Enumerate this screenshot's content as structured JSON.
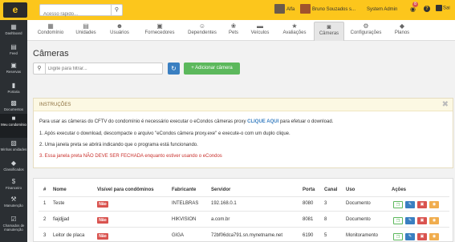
{
  "topbar": {
    "logo": "e",
    "search_placeholder": "Acesso rápido...",
    "search_icon": "search-icon",
    "user1": "Alfa",
    "user2": "Bruno Souzados s...",
    "role": "System Admin",
    "notifications": "8",
    "help": "?",
    "logout": "Sai"
  },
  "sidebar": {
    "items": [
      {
        "label": "Dashboard",
        "icon": "dashboard-icon"
      },
      {
        "label": "Feed",
        "icon": "feed-icon"
      },
      {
        "label": "Reservas",
        "icon": "calendar-icon"
      },
      {
        "label": "Portaria",
        "icon": "door-icon"
      },
      {
        "label": "Documentos",
        "icon": "documents-icon"
      },
      {
        "label": "Meu condomínio",
        "icon": "building-icon"
      },
      {
        "label": "Minhas unidades",
        "icon": "units-icon"
      },
      {
        "label": "Classificados",
        "icon": "classifieds-icon"
      },
      {
        "label": "Financeiro",
        "icon": "dollar-icon"
      },
      {
        "label": "Manutenção",
        "icon": "wrench-icon"
      },
      {
        "label": "Chamados de manutenção",
        "icon": "ticket-icon"
      }
    ]
  },
  "tabs": [
    {
      "label": "Condomínio",
      "icon": "▦"
    },
    {
      "label": "Unidades",
      "icon": "▤"
    },
    {
      "label": "Usuários",
      "icon": "☻"
    },
    {
      "label": "Fornecedores",
      "icon": "▣"
    },
    {
      "label": "Dependentes",
      "icon": "☺"
    },
    {
      "label": "Pets",
      "icon": "❀"
    },
    {
      "label": "Veículos",
      "icon": "▬"
    },
    {
      "label": "Avaliações",
      "icon": "★"
    },
    {
      "label": "Câmeras",
      "icon": "◙"
    },
    {
      "label": "Configurações",
      "icon": "⚙"
    },
    {
      "label": "Planos",
      "icon": "◆"
    }
  ],
  "page": {
    "title": "Câmeras",
    "filter_placeholder": "Digite para filtrar...",
    "add_camera": "+ Adicionar câmera"
  },
  "instructions": {
    "header": "INSTRUÇÕES",
    "line1_pre": "Para usar as câmeras do CFTV do condomínio é necessário executar o eCondos câmeras proxy",
    "line1_link": "CLIQUE AQUI",
    "line1_post": "para efetuar o download.",
    "line2": "1. Após executar o download, descompacte o arquivo \"eCondos câmera proxy.exe\" e execute-o com um duplo clique.",
    "line3": "2. Uma janela preta se abrirá indicando que o programa está funcionando.",
    "line4": "3. Essa janela preta NÃO DEVE SER FECHADA enquanto estiver usando o eCondos"
  },
  "table": {
    "headers": [
      "#",
      "Nome",
      "Visível para condôminos",
      "Fabricante",
      "Servidor",
      "Porta",
      "Canal",
      "Uso",
      "Ações"
    ],
    "rows": [
      {
        "n": "1",
        "nome": "Teste",
        "visivel": "Não",
        "fabricante": "INTELBRAS",
        "servidor": "192.168.0.1",
        "porta": "8080",
        "canal": "3",
        "uso": "Documento"
      },
      {
        "n": "2",
        "nome": "fiajdjjad",
        "visivel": "Não",
        "fabricante": "HIKVISION",
        "servidor": "a.com.br",
        "porta": "8081",
        "canal": "8",
        "uso": "Documento"
      },
      {
        "n": "3",
        "nome": "Leitor de placa",
        "visivel": "Não",
        "fabricante": "GIGA",
        "servidor": "72bf06dca791.sn.mynetname.net",
        "porta": "6190",
        "canal": "5",
        "uso": "Monitoramento"
      }
    ]
  },
  "colors": {
    "brand": "#fcc61c",
    "sidebar": "#2b2f33",
    "primary": "#3a7fc1",
    "success": "#5cb85c",
    "danger": "#d9534f",
    "warning": "#f0ad4e"
  }
}
